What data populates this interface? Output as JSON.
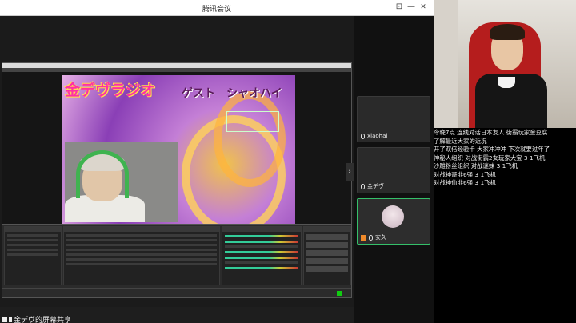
{
  "window": {
    "title": "腾讯会议"
  },
  "window_controls": {
    "pin": "⊡",
    "minimize": "—",
    "maximize": "☐",
    "close": "✕"
  },
  "shared_screen": {
    "banner_text": "金デヴラジオ",
    "guest_text": "ゲスト　シャオハイ",
    "label": "金デヴ的屏幕共享"
  },
  "participants": [
    {
      "name": "xiaohai",
      "active": false
    },
    {
      "name": "金デヴ",
      "active": false
    },
    {
      "name": "安久",
      "active": true,
      "host": true
    }
  ],
  "collapse_glyph": "›",
  "notes": [
    "今晚7点  连线对话日本友人 街霸玩家金豆腐",
    "了解最近大家的近况",
    "开了双倍经验卡  大家冲冲冲  下次就要过年了",
    "神秘人组织  对战街霸2女玩家大宝  3  1飞机",
    "沙雕粉丝组织  对战谜妹  3  1飞机",
    "对战神哥非6强  3  1飞机",
    "对战神仙非6强  3  1飞机"
  ]
}
